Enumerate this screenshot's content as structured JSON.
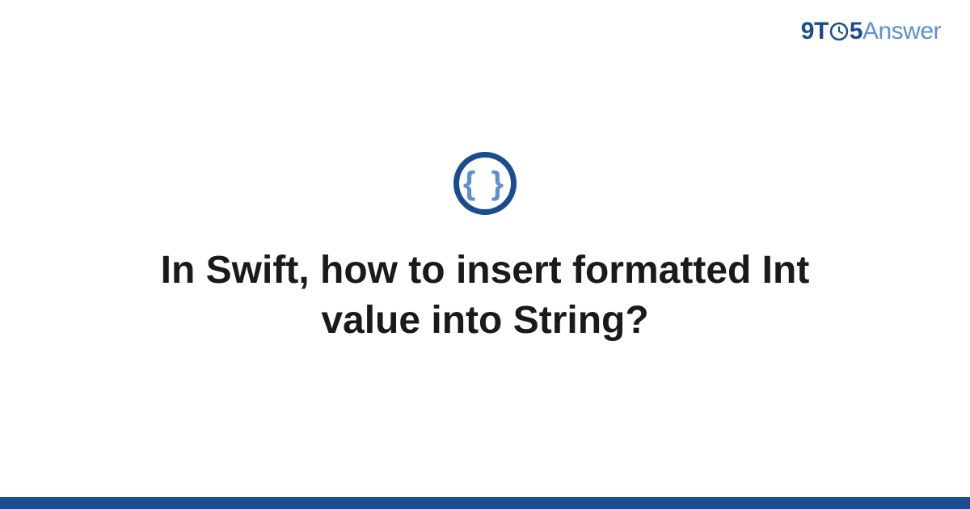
{
  "logo": {
    "part1": "9",
    "part2": "T",
    "part3": "5",
    "part4": "Answer"
  },
  "icon": {
    "glyph": "{ }"
  },
  "title": "In Swift, how to insert formatted Int value into String?"
}
